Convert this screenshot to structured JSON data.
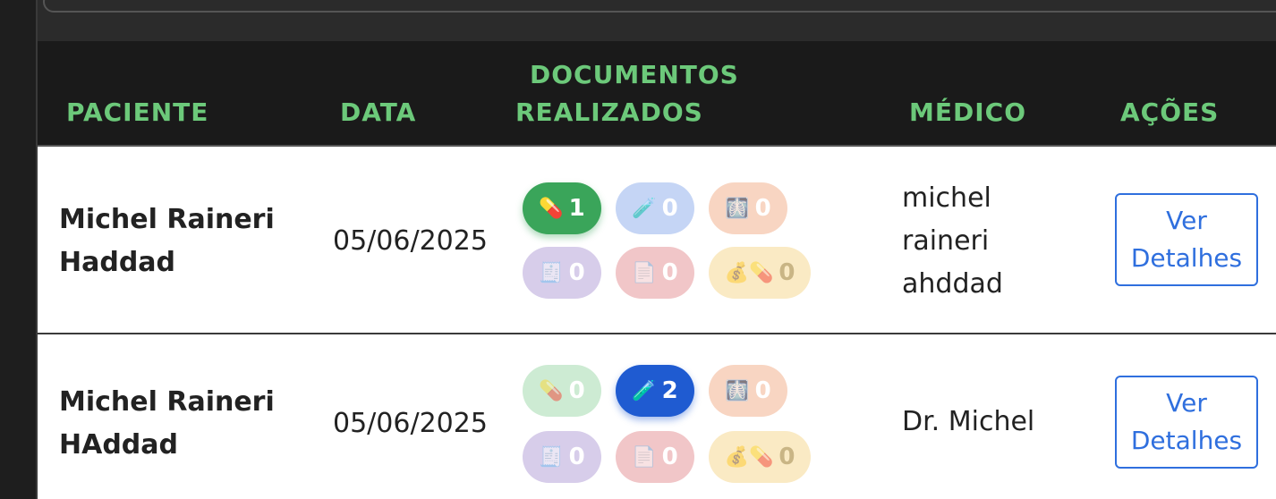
{
  "table": {
    "headers": {
      "patient": "PACIENTE",
      "date": "DATA",
      "documents_line1": "DOCUMENTOS",
      "documents_line2": "REALIZADOS",
      "doctor": "MÉDICO",
      "actions": "AÇÕES"
    },
    "rows": [
      {
        "patient_line1": "Michel Raineri",
        "patient_line2": "Haddad",
        "date": "05/06/2025",
        "badges": {
          "prescriptions": "1",
          "exams": "0",
          "imaging": "0",
          "reports": "0",
          "certificates": "0",
          "costly_meds": "0"
        },
        "doctor_line1": "michel",
        "doctor_line2": "raineri",
        "doctor_line3": "ahddad",
        "action_line1": "Ver",
        "action_line2": "Detalhes"
      },
      {
        "patient_line1": "Michel Raineri",
        "patient_line2": "HAddad",
        "date": "05/06/2025",
        "badges": {
          "prescriptions": "0",
          "exams": "2",
          "imaging": "0",
          "reports": "0",
          "certificates": "0",
          "costly_meds": "0"
        },
        "doctor_line1": "Dr. Michel",
        "action_line1": "Ver",
        "action_line2": "Detalhes"
      }
    ]
  },
  "icons": {
    "prescriptions": "pill-icon",
    "exams": "test-tube-icon",
    "imaging": "xray-icon",
    "reports": "receipt-icon",
    "certificates": "document-icon",
    "costly_meds": "money-pill-icon"
  },
  "colors": {
    "header_text": "#6cc97a",
    "button_blue": "#2f6fde",
    "prescriptions_active": "#3aa55a",
    "exams_active": "#1f5bd1"
  }
}
